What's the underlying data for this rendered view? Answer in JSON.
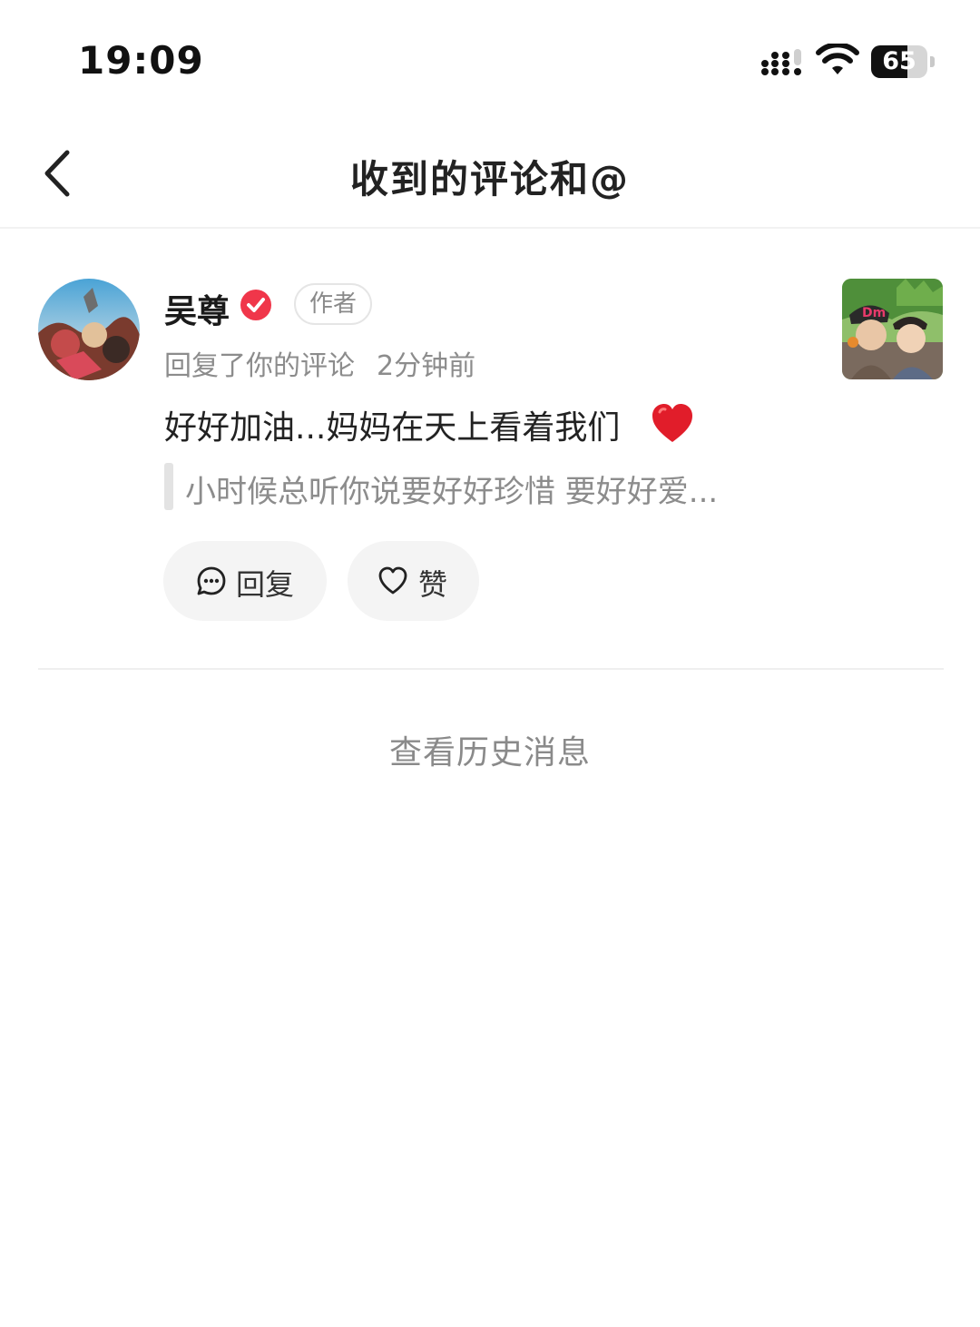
{
  "status_bar": {
    "time": "19:09",
    "battery": "65",
    "battery_level": 0.65
  },
  "nav": {
    "title": "收到的评论和@",
    "back_icon": "chevron-left-icon"
  },
  "comment": {
    "user_name": "吴尊",
    "verified_icon": "verified-check-icon",
    "author_badge": "作者",
    "action_text": "回复了你的评论",
    "time_ago": "2分钟前",
    "text": "好好加油...妈妈在天上看着我们",
    "emoji": "red-heart-icon",
    "quoted_text": "小时候总听你说要好好珍惜 要好好爱...",
    "reply_label": "回复",
    "like_label": "赞"
  },
  "footer": {
    "history_label": "查看历史消息"
  },
  "colors": {
    "verified_red": "#f0364a",
    "muted_text": "#8c8c8c",
    "button_bg": "#f4f4f4"
  }
}
